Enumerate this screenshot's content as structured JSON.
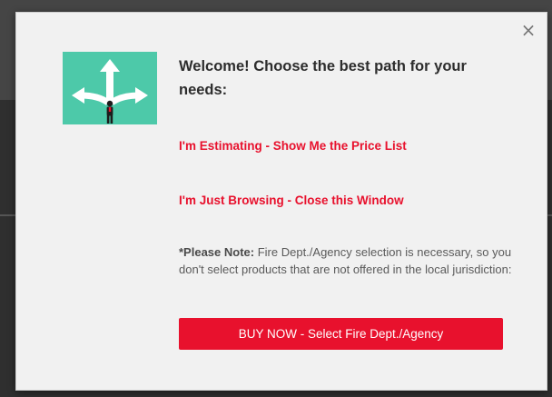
{
  "modal": {
    "close_label": "×",
    "image_icon": "crossroads-arrows-illustration",
    "title": "Welcome! Choose the best path for your needs:",
    "link_estimating": "I'm Estimating - Show Me the Price List",
    "link_browsing": "I'm Just Browsing - Close this Window",
    "note_label": "*Please Note:",
    "note_text": "Fire Dept./Agency selection is necessary, so you don't select products that are not offered in the local jurisdiction:",
    "buy_button": "BUY NOW - Select Fire Dept./Agency"
  },
  "colors": {
    "accent": "#e8112d",
    "image_bg": "#4dc9a9",
    "modal_bg": "#f1f1f1",
    "overlay": "#3a3a3a"
  }
}
